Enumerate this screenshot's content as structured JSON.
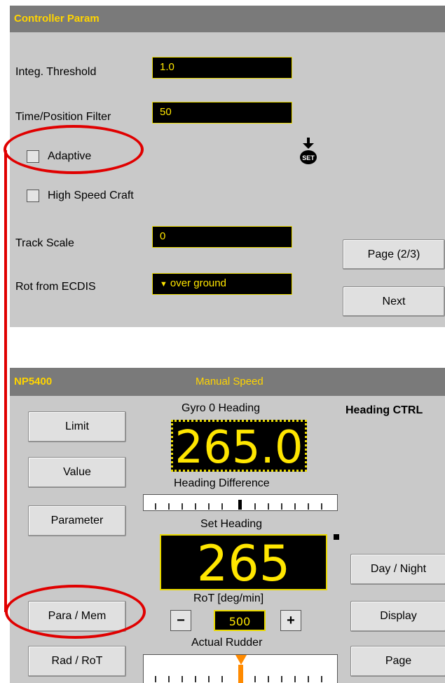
{
  "colors": {
    "panel": "#c9c9c9",
    "title_bar": "#7a7a7a",
    "title_text": "#ffd400",
    "field_bg": "#000000",
    "field_text": "#ffe600",
    "annotation": "#e00000"
  },
  "controller": {
    "title": "Controller Param",
    "integ_threshold": {
      "label": "Integ. Threshold",
      "value": "1.0"
    },
    "time_position_filter": {
      "label": "Time/Position Filter",
      "value": "50"
    },
    "adaptive": {
      "label": "Adaptive",
      "checked": false
    },
    "high_speed_craft": {
      "label": "High Speed Craft",
      "checked": false
    },
    "track_scale": {
      "label": "Track Scale",
      "value": "0"
    },
    "rot_from_ecdis": {
      "label": "Rot from ECDIS",
      "value": "over ground"
    },
    "set_icon": "set-icon",
    "page_button": "Page (2/3)",
    "next_button": "Next"
  },
  "np": {
    "title": "NP5400",
    "mode": "Manual Speed",
    "heading_ctrl_label": "Heading CTRL",
    "left_buttons": [
      "Limit",
      "Value",
      "Parameter",
      "Para / Mem",
      "Rad / RoT"
    ],
    "right_buttons": [
      "Day / Night",
      "Display",
      "Page"
    ],
    "gyro_label": "Gyro 0 Heading",
    "gyro_value": "265.0",
    "heading_diff_label": "Heading Difference",
    "set_heading_label": "Set Heading",
    "set_heading_value": "265",
    "rot_label": "RoT [deg/min]",
    "rot_value": "500",
    "minus": "−",
    "plus": "+",
    "actual_rudder_label": "Actual Rudder",
    "heading_difference": 0,
    "actual_rudder": 0
  }
}
